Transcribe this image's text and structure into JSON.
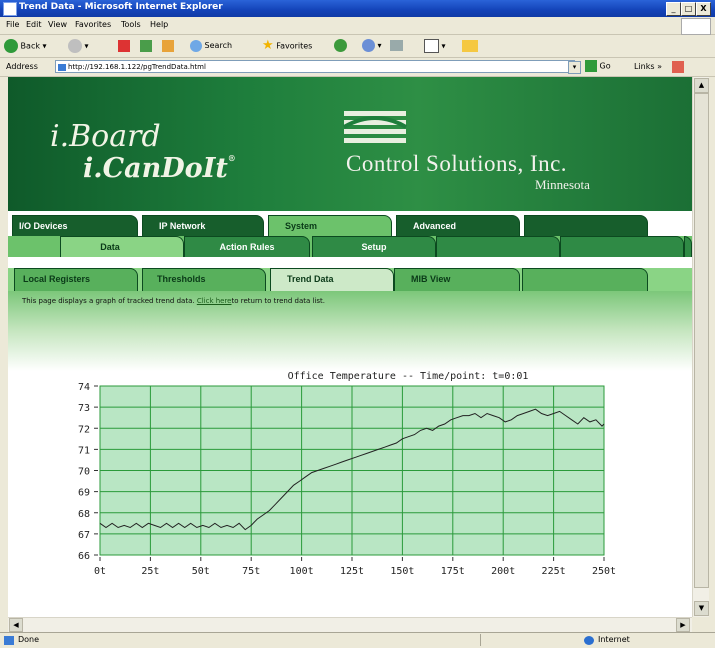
{
  "window": {
    "title": "Trend Data - Microsoft Internet Explorer",
    "minimize": "_",
    "maximize": "□",
    "close": "X"
  },
  "menu": [
    "File",
    "Edit",
    "View",
    "Favorites",
    "Tools",
    "Help"
  ],
  "toolbar": {
    "back": "Back",
    "search": "Search",
    "favorites": "Favorites"
  },
  "address": {
    "label": "Address",
    "url": "http://192.168.1.122/pgTrendData.html",
    "go": "Go",
    "links": "Links",
    "more": "»"
  },
  "logo": {
    "line1": "i.Board",
    "line2": "i.CanDoIt",
    "mark": "®"
  },
  "company": {
    "name": "Control Solutions, Inc.",
    "state": "Minnesota"
  },
  "tabs": {
    "row1": [
      "I/O Devices",
      "IP Network",
      "System",
      "Advanced",
      ""
    ],
    "row2": [
      "Data",
      "Action Rules",
      "Setup",
      "",
      "",
      ""
    ],
    "row3": [
      "Local Registers",
      "Thresholds",
      "Trend Data",
      "MIB View",
      ""
    ]
  },
  "page": {
    "description_pre": "This page displays a graph of tracked trend data. ",
    "link": "Click here",
    "description_post": "to return to trend data list."
  },
  "status": {
    "text": "Done",
    "zone": "Internet"
  },
  "colors": {
    "plot_bg": "#b9e6c4",
    "grid": "#2a9a3a",
    "line": "#222222",
    "brand_green": "#1e7e3c"
  },
  "chart_data": {
    "type": "line",
    "title": "Office Temperature -- Time/point: t=0:01",
    "xlabel": "",
    "ylabel": "",
    "xlim": [
      0,
      250
    ],
    "ylim": [
      66,
      74
    ],
    "yticks": [
      66,
      67,
      68,
      69,
      70,
      71,
      72,
      73,
      74
    ],
    "xticks": [
      "0t",
      "25t",
      "50t",
      "75t",
      "100t",
      "125t",
      "150t",
      "175t",
      "200t",
      "225t",
      "250t"
    ],
    "grid": true,
    "series": [
      {
        "name": "",
        "x": [
          0,
          3,
          6,
          9,
          12,
          15,
          18,
          21,
          24,
          27,
          30,
          33,
          36,
          39,
          42,
          45,
          48,
          51,
          54,
          57,
          60,
          63,
          66,
          69,
          72,
          75,
          78,
          81,
          84,
          87,
          90,
          93,
          96,
          99,
          102,
          105,
          108,
          111,
          114,
          117,
          120,
          123,
          126,
          129,
          132,
          135,
          138,
          141,
          144,
          147,
          150,
          153,
          156,
          159,
          162,
          165,
          168,
          171,
          174,
          177,
          180,
          183,
          186,
          189,
          192,
          195,
          198,
          201,
          204,
          207,
          210,
          213,
          216,
          219,
          222,
          225,
          228,
          231,
          234,
          237,
          240,
          243,
          246,
          249,
          250
        ],
        "y": [
          67.5,
          67.3,
          67.5,
          67.3,
          67.4,
          67.3,
          67.5,
          67.3,
          67.5,
          67.4,
          67.3,
          67.5,
          67.3,
          67.5,
          67.3,
          67.5,
          67.3,
          67.4,
          67.3,
          67.5,
          67.3,
          67.4,
          67.3,
          67.5,
          67.2,
          67.4,
          67.7,
          67.9,
          68.1,
          68.4,
          68.7,
          69.0,
          69.3,
          69.5,
          69.7,
          69.9,
          70.0,
          70.1,
          70.2,
          70.3,
          70.4,
          70.5,
          70.6,
          70.7,
          70.8,
          70.9,
          71.0,
          71.1,
          71.2,
          71.3,
          71.5,
          71.6,
          71.7,
          71.9,
          72.0,
          71.9,
          72.1,
          72.2,
          72.4,
          72.5,
          72.6,
          72.6,
          72.7,
          72.5,
          72.7,
          72.6,
          72.5,
          72.3,
          72.4,
          72.6,
          72.7,
          72.8,
          72.9,
          72.7,
          72.6,
          72.7,
          72.8,
          72.6,
          72.4,
          72.2,
          72.5,
          72.3,
          72.4,
          72.1,
          72.2
        ]
      }
    ]
  }
}
